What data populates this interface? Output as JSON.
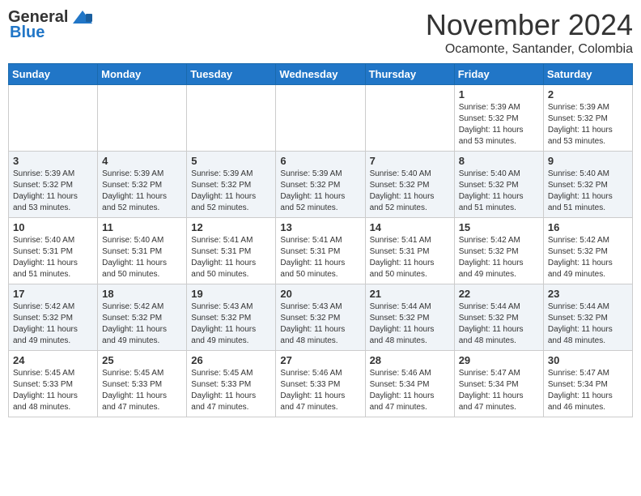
{
  "header": {
    "logo_general": "General",
    "logo_blue": "Blue",
    "month": "November 2024",
    "location": "Ocamonte, Santander, Colombia"
  },
  "weekdays": [
    "Sunday",
    "Monday",
    "Tuesday",
    "Wednesday",
    "Thursday",
    "Friday",
    "Saturday"
  ],
  "weeks": [
    [
      {
        "day": "",
        "info": ""
      },
      {
        "day": "",
        "info": ""
      },
      {
        "day": "",
        "info": ""
      },
      {
        "day": "",
        "info": ""
      },
      {
        "day": "",
        "info": ""
      },
      {
        "day": "1",
        "info": "Sunrise: 5:39 AM\nSunset: 5:32 PM\nDaylight: 11 hours\nand 53 minutes."
      },
      {
        "day": "2",
        "info": "Sunrise: 5:39 AM\nSunset: 5:32 PM\nDaylight: 11 hours\nand 53 minutes."
      }
    ],
    [
      {
        "day": "3",
        "info": "Sunrise: 5:39 AM\nSunset: 5:32 PM\nDaylight: 11 hours\nand 53 minutes."
      },
      {
        "day": "4",
        "info": "Sunrise: 5:39 AM\nSunset: 5:32 PM\nDaylight: 11 hours\nand 52 minutes."
      },
      {
        "day": "5",
        "info": "Sunrise: 5:39 AM\nSunset: 5:32 PM\nDaylight: 11 hours\nand 52 minutes."
      },
      {
        "day": "6",
        "info": "Sunrise: 5:39 AM\nSunset: 5:32 PM\nDaylight: 11 hours\nand 52 minutes."
      },
      {
        "day": "7",
        "info": "Sunrise: 5:40 AM\nSunset: 5:32 PM\nDaylight: 11 hours\nand 52 minutes."
      },
      {
        "day": "8",
        "info": "Sunrise: 5:40 AM\nSunset: 5:32 PM\nDaylight: 11 hours\nand 51 minutes."
      },
      {
        "day": "9",
        "info": "Sunrise: 5:40 AM\nSunset: 5:32 PM\nDaylight: 11 hours\nand 51 minutes."
      }
    ],
    [
      {
        "day": "10",
        "info": "Sunrise: 5:40 AM\nSunset: 5:31 PM\nDaylight: 11 hours\nand 51 minutes."
      },
      {
        "day": "11",
        "info": "Sunrise: 5:40 AM\nSunset: 5:31 PM\nDaylight: 11 hours\nand 50 minutes."
      },
      {
        "day": "12",
        "info": "Sunrise: 5:41 AM\nSunset: 5:31 PM\nDaylight: 11 hours\nand 50 minutes."
      },
      {
        "day": "13",
        "info": "Sunrise: 5:41 AM\nSunset: 5:31 PM\nDaylight: 11 hours\nand 50 minutes."
      },
      {
        "day": "14",
        "info": "Sunrise: 5:41 AM\nSunset: 5:31 PM\nDaylight: 11 hours\nand 50 minutes."
      },
      {
        "day": "15",
        "info": "Sunrise: 5:42 AM\nSunset: 5:32 PM\nDaylight: 11 hours\nand 49 minutes."
      },
      {
        "day": "16",
        "info": "Sunrise: 5:42 AM\nSunset: 5:32 PM\nDaylight: 11 hours\nand 49 minutes."
      }
    ],
    [
      {
        "day": "17",
        "info": "Sunrise: 5:42 AM\nSunset: 5:32 PM\nDaylight: 11 hours\nand 49 minutes."
      },
      {
        "day": "18",
        "info": "Sunrise: 5:42 AM\nSunset: 5:32 PM\nDaylight: 11 hours\nand 49 minutes."
      },
      {
        "day": "19",
        "info": "Sunrise: 5:43 AM\nSunset: 5:32 PM\nDaylight: 11 hours\nand 49 minutes."
      },
      {
        "day": "20",
        "info": "Sunrise: 5:43 AM\nSunset: 5:32 PM\nDaylight: 11 hours\nand 48 minutes."
      },
      {
        "day": "21",
        "info": "Sunrise: 5:44 AM\nSunset: 5:32 PM\nDaylight: 11 hours\nand 48 minutes."
      },
      {
        "day": "22",
        "info": "Sunrise: 5:44 AM\nSunset: 5:32 PM\nDaylight: 11 hours\nand 48 minutes."
      },
      {
        "day": "23",
        "info": "Sunrise: 5:44 AM\nSunset: 5:32 PM\nDaylight: 11 hours\nand 48 minutes."
      }
    ],
    [
      {
        "day": "24",
        "info": "Sunrise: 5:45 AM\nSunset: 5:33 PM\nDaylight: 11 hours\nand 48 minutes."
      },
      {
        "day": "25",
        "info": "Sunrise: 5:45 AM\nSunset: 5:33 PM\nDaylight: 11 hours\nand 47 minutes."
      },
      {
        "day": "26",
        "info": "Sunrise: 5:45 AM\nSunset: 5:33 PM\nDaylight: 11 hours\nand 47 minutes."
      },
      {
        "day": "27",
        "info": "Sunrise: 5:46 AM\nSunset: 5:33 PM\nDaylight: 11 hours\nand 47 minutes."
      },
      {
        "day": "28",
        "info": "Sunrise: 5:46 AM\nSunset: 5:34 PM\nDaylight: 11 hours\nand 47 minutes."
      },
      {
        "day": "29",
        "info": "Sunrise: 5:47 AM\nSunset: 5:34 PM\nDaylight: 11 hours\nand 47 minutes."
      },
      {
        "day": "30",
        "info": "Sunrise: 5:47 AM\nSunset: 5:34 PM\nDaylight: 11 hours\nand 46 minutes."
      }
    ]
  ]
}
